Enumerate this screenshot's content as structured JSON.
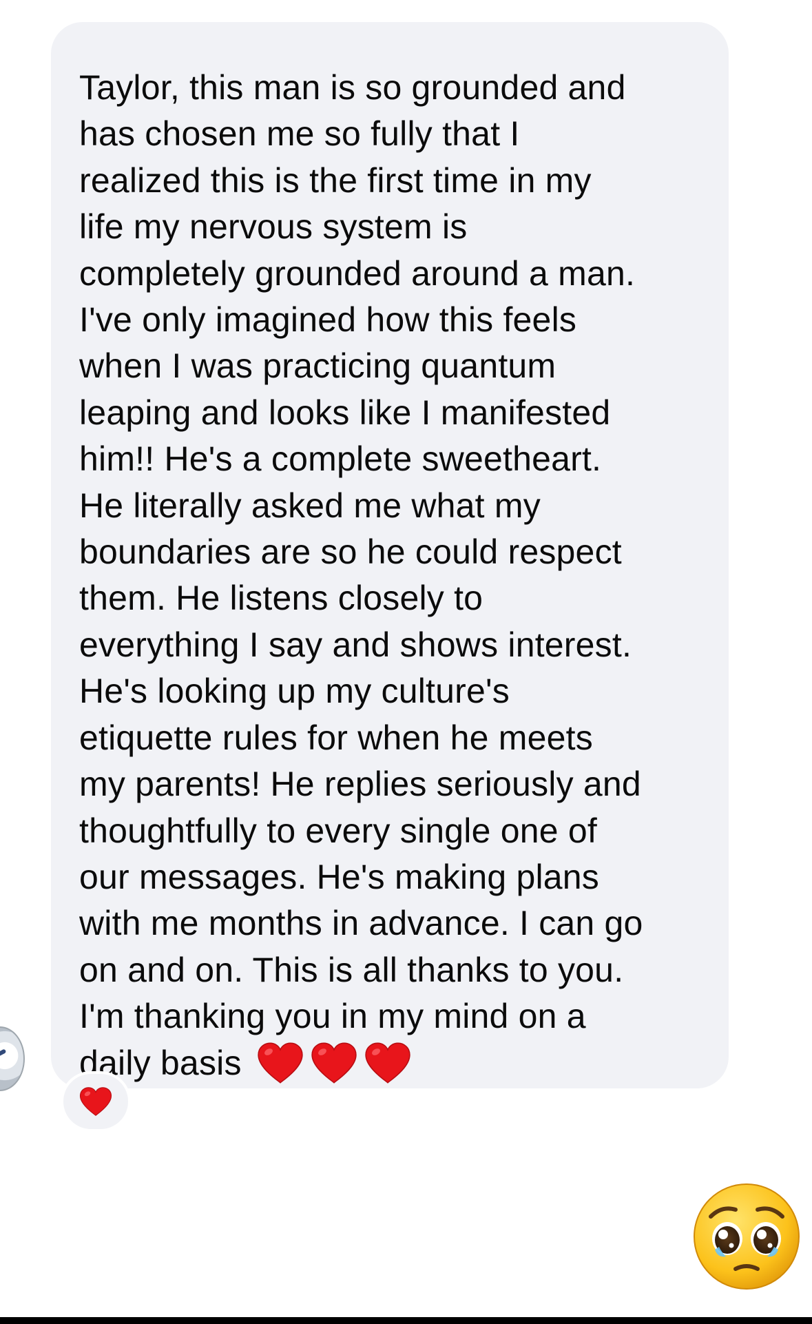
{
  "message": {
    "lines": [
      "Taylor, this man is so grounded and",
      "has chosen me so fully that I",
      "realized this is the first time in my",
      "life my nervous system is",
      "completely grounded around a man.",
      "I've only imagined how this feels",
      "when I was practicing quantum",
      "leaping and looks like I manifested",
      "him!! He's a complete sweetheart.",
      "He literally asked me what my",
      "boundaries are so he could respect",
      "them. He listens closely to",
      "everything I say and shows interest.",
      "He's looking up my culture's",
      "etiquette rules for when he meets",
      "my parents! He replies seriously and",
      "thoughtfully to every single one of",
      "our messages. He's making plans",
      "with me months in advance. I can go",
      "on and on. This is all thanks to you.",
      "I'm thanking you in my mind on a",
      "daily basis"
    ],
    "trailing_emoji": [
      "red-heart",
      "red-heart",
      "red-heart"
    ],
    "reaction": "red-heart",
    "bubble_color": "#f1f2f6",
    "text_color": "#0b0b0b"
  },
  "reply_emoji": "pleading-face"
}
